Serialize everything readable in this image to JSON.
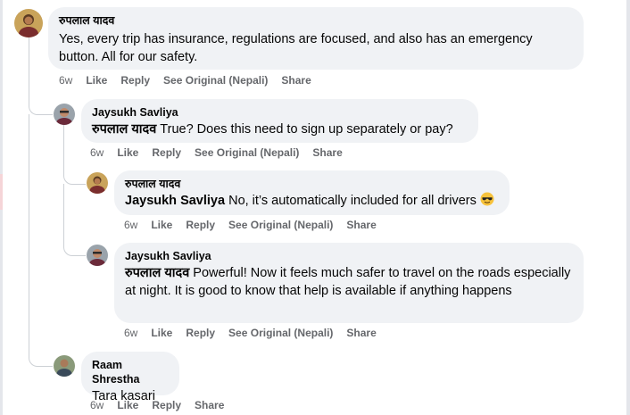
{
  "comments": [
    {
      "author": "रुपलाल यादव",
      "mention": "",
      "text": "Yes, every trip has insurance, regulations are focused, and also has an emergency button. All for our safety.",
      "time": "6w",
      "like": "Like",
      "reply": "Reply",
      "see_original": "See Original (Nepali)",
      "share": "Share"
    },
    {
      "author": "Jaysukh Savliya",
      "mention": "रुपलाल यादव",
      "text": " True? Does this need to sign up separately or pay?",
      "time": "6w",
      "like": "Like",
      "reply": "Reply",
      "see_original": "See Original (Nepali)",
      "share": "Share"
    },
    {
      "author": "रुपलाल यादव",
      "mention": "Jaysukh Savliya",
      "text": " No, it’s automatically included for all drivers",
      "emoji": "smiling-face-with-sunglasses",
      "time": "6w",
      "like": "Like",
      "reply": "Reply",
      "see_original": "See Original (Nepali)",
      "share": "Share"
    },
    {
      "author": "Jaysukh Savliya",
      "mention": "रुपलाल यादव",
      "text": " Powerful! Now it feels much safer to travel on the roads especially at night. It is good to know that help is available if anything happens",
      "time": "6w",
      "like": "Like",
      "reply": "Reply",
      "see_original": "See Original (Nepali)",
      "share": "Share"
    },
    {
      "author": "Raam Shrestha",
      "mention": "",
      "text": "Tara kasari",
      "time": "6w",
      "like": "Like",
      "reply": "Reply",
      "share": "Share"
    }
  ],
  "colors": {
    "bubble": "#f0f2f5",
    "meta_text": "#65676b",
    "thread_line": "#ccd0d5"
  }
}
